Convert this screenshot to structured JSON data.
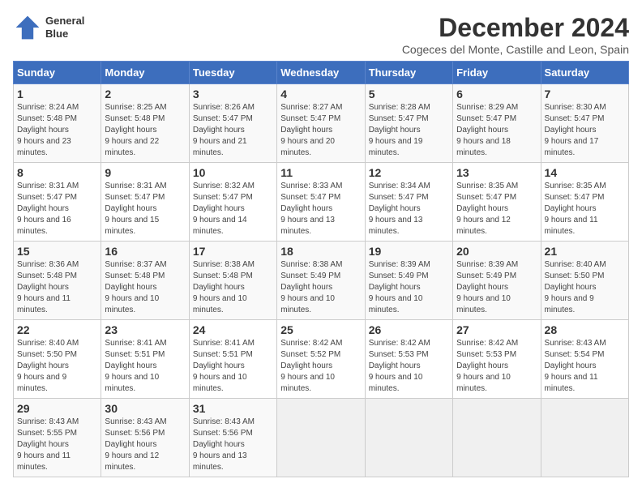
{
  "logo": {
    "line1": "General",
    "line2": "Blue"
  },
  "title": "December 2024",
  "subtitle": "Cogeces del Monte, Castille and Leon, Spain",
  "days_of_week": [
    "Sunday",
    "Monday",
    "Tuesday",
    "Wednesday",
    "Thursday",
    "Friday",
    "Saturday"
  ],
  "weeks": [
    [
      {
        "day": "1",
        "sunrise": "8:24 AM",
        "sunset": "5:48 PM",
        "daylight": "9 hours and 23 minutes."
      },
      {
        "day": "2",
        "sunrise": "8:25 AM",
        "sunset": "5:48 PM",
        "daylight": "9 hours and 22 minutes."
      },
      {
        "day": "3",
        "sunrise": "8:26 AM",
        "sunset": "5:47 PM",
        "daylight": "9 hours and 21 minutes."
      },
      {
        "day": "4",
        "sunrise": "8:27 AM",
        "sunset": "5:47 PM",
        "daylight": "9 hours and 20 minutes."
      },
      {
        "day": "5",
        "sunrise": "8:28 AM",
        "sunset": "5:47 PM",
        "daylight": "9 hours and 19 minutes."
      },
      {
        "day": "6",
        "sunrise": "8:29 AM",
        "sunset": "5:47 PM",
        "daylight": "9 hours and 18 minutes."
      },
      {
        "day": "7",
        "sunrise": "8:30 AM",
        "sunset": "5:47 PM",
        "daylight": "9 hours and 17 minutes."
      }
    ],
    [
      {
        "day": "8",
        "sunrise": "8:31 AM",
        "sunset": "5:47 PM",
        "daylight": "9 hours and 16 minutes."
      },
      {
        "day": "9",
        "sunrise": "8:31 AM",
        "sunset": "5:47 PM",
        "daylight": "9 hours and 15 minutes."
      },
      {
        "day": "10",
        "sunrise": "8:32 AM",
        "sunset": "5:47 PM",
        "daylight": "9 hours and 14 minutes."
      },
      {
        "day": "11",
        "sunrise": "8:33 AM",
        "sunset": "5:47 PM",
        "daylight": "9 hours and 13 minutes."
      },
      {
        "day": "12",
        "sunrise": "8:34 AM",
        "sunset": "5:47 PM",
        "daylight": "9 hours and 13 minutes."
      },
      {
        "day": "13",
        "sunrise": "8:35 AM",
        "sunset": "5:47 PM",
        "daylight": "9 hours and 12 minutes."
      },
      {
        "day": "14",
        "sunrise": "8:35 AM",
        "sunset": "5:47 PM",
        "daylight": "9 hours and 11 minutes."
      }
    ],
    [
      {
        "day": "15",
        "sunrise": "8:36 AM",
        "sunset": "5:48 PM",
        "daylight": "9 hours and 11 minutes."
      },
      {
        "day": "16",
        "sunrise": "8:37 AM",
        "sunset": "5:48 PM",
        "daylight": "9 hours and 10 minutes."
      },
      {
        "day": "17",
        "sunrise": "8:38 AM",
        "sunset": "5:48 PM",
        "daylight": "9 hours and 10 minutes."
      },
      {
        "day": "18",
        "sunrise": "8:38 AM",
        "sunset": "5:49 PM",
        "daylight": "9 hours and 10 minutes."
      },
      {
        "day": "19",
        "sunrise": "8:39 AM",
        "sunset": "5:49 PM",
        "daylight": "9 hours and 10 minutes."
      },
      {
        "day": "20",
        "sunrise": "8:39 AM",
        "sunset": "5:49 PM",
        "daylight": "9 hours and 10 minutes."
      },
      {
        "day": "21",
        "sunrise": "8:40 AM",
        "sunset": "5:50 PM",
        "daylight": "9 hours and 9 minutes."
      }
    ],
    [
      {
        "day": "22",
        "sunrise": "8:40 AM",
        "sunset": "5:50 PM",
        "daylight": "9 hours and 9 minutes."
      },
      {
        "day": "23",
        "sunrise": "8:41 AM",
        "sunset": "5:51 PM",
        "daylight": "9 hours and 10 minutes."
      },
      {
        "day": "24",
        "sunrise": "8:41 AM",
        "sunset": "5:51 PM",
        "daylight": "9 hours and 10 minutes."
      },
      {
        "day": "25",
        "sunrise": "8:42 AM",
        "sunset": "5:52 PM",
        "daylight": "9 hours and 10 minutes."
      },
      {
        "day": "26",
        "sunrise": "8:42 AM",
        "sunset": "5:53 PM",
        "daylight": "9 hours and 10 minutes."
      },
      {
        "day": "27",
        "sunrise": "8:42 AM",
        "sunset": "5:53 PM",
        "daylight": "9 hours and 10 minutes."
      },
      {
        "day": "28",
        "sunrise": "8:43 AM",
        "sunset": "5:54 PM",
        "daylight": "9 hours and 11 minutes."
      }
    ],
    [
      {
        "day": "29",
        "sunrise": "8:43 AM",
        "sunset": "5:55 PM",
        "daylight": "9 hours and 11 minutes."
      },
      {
        "day": "30",
        "sunrise": "8:43 AM",
        "sunset": "5:56 PM",
        "daylight": "9 hours and 12 minutes."
      },
      {
        "day": "31",
        "sunrise": "8:43 AM",
        "sunset": "5:56 PM",
        "daylight": "9 hours and 13 minutes."
      },
      null,
      null,
      null,
      null
    ]
  ]
}
